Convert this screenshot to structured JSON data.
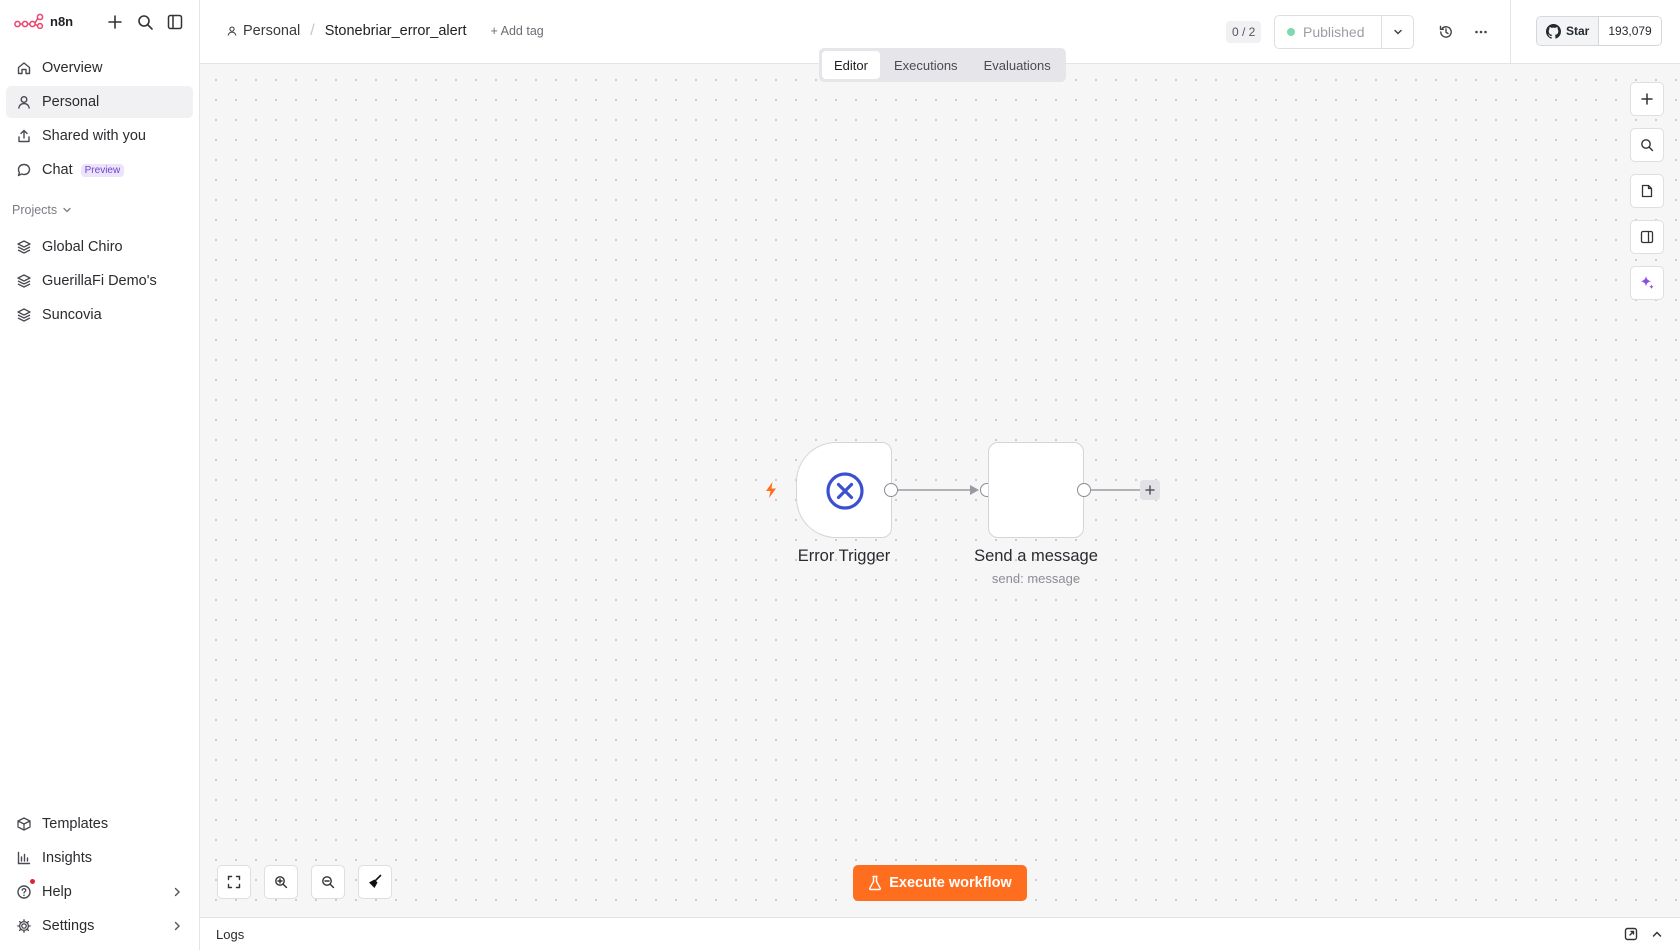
{
  "app": {
    "name": "n8n"
  },
  "sidebar": {
    "nav": [
      {
        "label": "Overview",
        "icon": "home-icon"
      },
      {
        "label": "Personal",
        "icon": "user-icon",
        "active": true
      },
      {
        "label": "Shared with you",
        "icon": "share-icon"
      },
      {
        "label": "Chat",
        "icon": "chat-icon",
        "badge": "Preview"
      }
    ],
    "projects_heading": "Projects",
    "projects": [
      {
        "label": "Global Chiro",
        "icon": "layers-icon"
      },
      {
        "label": "GuerillaFi Demo's",
        "icon": "layers-icon"
      },
      {
        "label": "Suncovia",
        "icon": "layers-icon"
      }
    ],
    "bottom": [
      {
        "label": "Templates",
        "icon": "templates-icon"
      },
      {
        "label": "Insights",
        "icon": "insights-icon"
      },
      {
        "label": "Help",
        "icon": "help-icon",
        "has_notification": true
      },
      {
        "label": "Settings",
        "icon": "settings-icon"
      }
    ]
  },
  "header": {
    "breadcrumb_project": "Personal",
    "workflow_name": "Stonebriar_error_alert",
    "add_tag": "+ Add tag",
    "counter": "0 / 2",
    "published_label": "Published",
    "github_star": "Star",
    "github_count": "193,079"
  },
  "tabs": [
    {
      "label": "Editor",
      "active": true
    },
    {
      "label": "Executions"
    },
    {
      "label": "Evaluations"
    }
  ],
  "canvas": {
    "nodes": [
      {
        "label": "Error Trigger",
        "subtitle": "",
        "type": "trigger"
      },
      {
        "label": "Send a message",
        "subtitle": "send: message",
        "type": "action"
      }
    ],
    "execute_button": "Execute workflow"
  },
  "logs": {
    "label": "Logs"
  },
  "colors": {
    "accent_orange": "#ff6d1f",
    "trigger_icon": "#3b4fd1",
    "published_dot": "#7fd8b0",
    "preview_badge": "#6f44c9",
    "ai_sparkle": "#8b4fe0"
  }
}
